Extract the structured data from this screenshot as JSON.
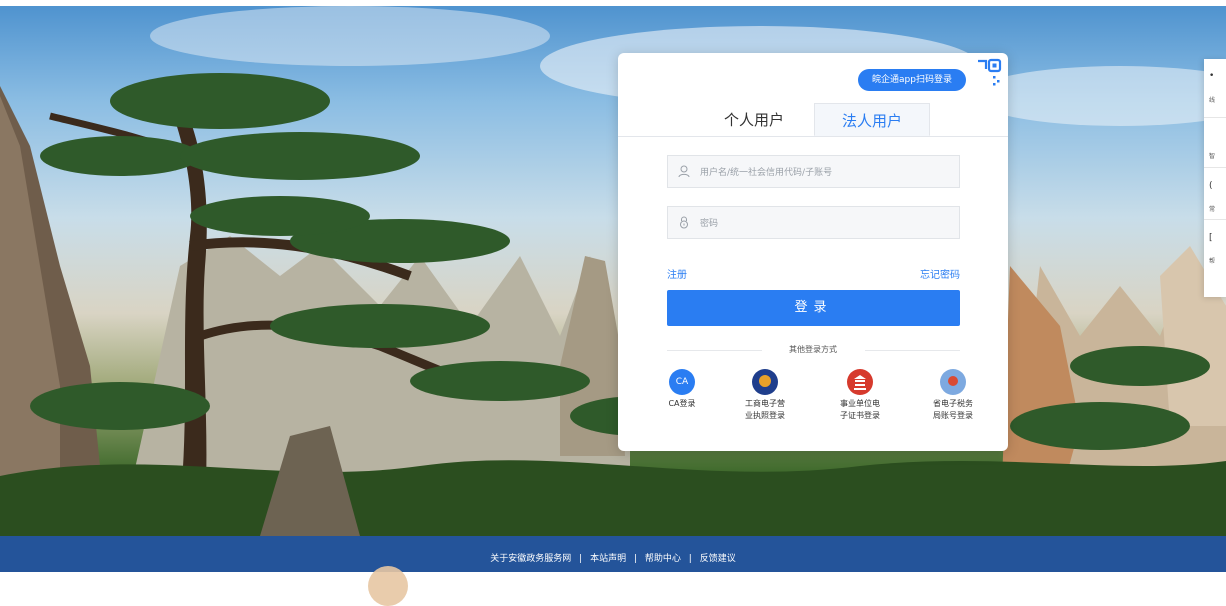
{
  "login": {
    "qr_login_label": "皖企通app扫码登录",
    "tabs": [
      {
        "label": "个人用户",
        "active": false
      },
      {
        "label": "法人用户",
        "active": true
      }
    ],
    "username_placeholder": "用户名/统一社会信用代码/子账号",
    "password_placeholder": "密码",
    "register_link": "注册",
    "forgot_link": "忘记密码",
    "submit_label": "登录",
    "other_methods_label": "其他登录方式",
    "methods": [
      {
        "line1": "CA登录",
        "line2": "",
        "icon_text": "CA",
        "icon": "ca-icon"
      },
      {
        "line1": "工商电子营",
        "line2": "业执照登录",
        "icon": "business-license-icon"
      },
      {
        "line1": "事业单位电",
        "line2": "子证书登录",
        "icon": "institution-cert-icon"
      },
      {
        "line1": "省电子税务",
        "line2": "局账号登录",
        "icon": "tax-bureau-icon"
      }
    ]
  },
  "side_panel": {
    "items": [
      "线",
      "智",
      "常",
      "帮"
    ]
  },
  "footer": {
    "links": [
      "关于安徽政务服务网",
      "本站声明",
      "帮助中心",
      "反馈建议"
    ],
    "separator": "|"
  },
  "colors": {
    "accent": "#2a7df2",
    "footer_bg": "#24549a"
  }
}
